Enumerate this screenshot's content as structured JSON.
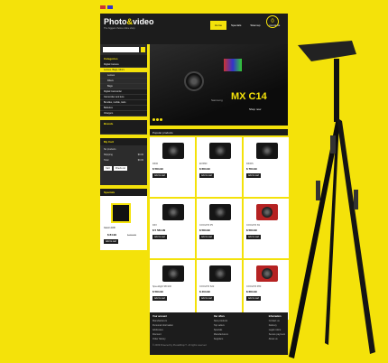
{
  "header": {
    "logo_main": "Photo",
    "logo_amp": "&",
    "logo_tail": "video",
    "tagline": "The biggest choice online shop",
    "nav": [
      "Home",
      "Specials",
      "Sitemap",
      "Contacts"
    ],
    "cart_count": "0"
  },
  "sidebar": {
    "categories_title": "Categories",
    "categories": [
      "Digital Camera",
      "Lenses, Bags, Mini's",
      "Lenses",
      "Filters",
      "Bags",
      "Digital Camcorder",
      "Camcorder and lens",
      "Bundles, mobile, tools",
      "Batteries",
      "Chargers"
    ],
    "brands_title": "Brands",
    "cart_title": "My Cart",
    "cart_empty": "No products",
    "cart_shipping_label": "Shipping",
    "cart_shipping_value": "$0.00",
    "cart_total_label": "Total",
    "cart_total_value": "$0.00",
    "cart_btn_cart": "Cart",
    "cart_btn_checkout": "Check out",
    "specials_title": "Specials",
    "special_name": "Canon 40D",
    "special_price": "$ 84.99",
    "special_old_price": "$ 90.99",
    "add_to_cart": "Add to cart"
  },
  "banner": {
    "brand": "Samsung",
    "model": "MX C14",
    "shop": "Shop now"
  },
  "products": {
    "title": "Popular products",
    "items": [
      {
        "name": "D300",
        "price": "$ 584.99",
        "red": false
      },
      {
        "name": "EOS5D",
        "price": "$ 684.99",
        "red": false
      },
      {
        "name": "D300S",
        "price": "$ 784.99",
        "red": false
      },
      {
        "name": "D3X",
        "price": "$ 5 584.99",
        "red": false
      },
      {
        "name": "COOLPIX P5",
        "price": "$ 584.99",
        "red": false
      },
      {
        "name": "COOLPIX S9",
        "price": "$ 584.99",
        "red": true
      },
      {
        "name": "Speedlight SB-900",
        "price": "$ 584.99",
        "red": false
      },
      {
        "name": "COOLPIX S22",
        "price": "$ 404.99",
        "red": false
      },
      {
        "name": "COOLPIX P80",
        "price": "$ 684.99",
        "red": true
      }
    ]
  },
  "footer": {
    "col1_title": "Your account",
    "col1": [
      "Manufacturers",
      "Personal information",
      "Addresses",
      "Discount",
      "Order history"
    ],
    "col2_title": "Our offers",
    "col2": [
      "New products",
      "Top sellers",
      "Specials",
      "Manufacturers",
      "Suppliers"
    ],
    "col3_title": "Information",
    "col3": [
      "Contact us",
      "Delivery",
      "Legal notice",
      "Secure payment",
      "About us"
    ],
    "copyright": "© 2009 Powered by PrestaShop™. All rights reserved"
  },
  "colors": {
    "accent": "#f4e20a",
    "dark": "#1c1c1c"
  }
}
